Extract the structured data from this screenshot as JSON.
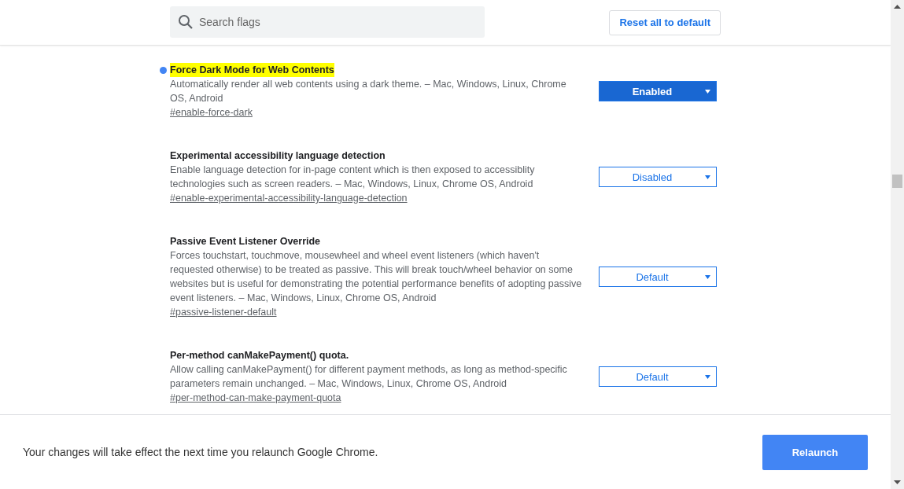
{
  "header": {
    "search": {
      "placeholder": "Search flags"
    },
    "reset_button": "Reset all to default"
  },
  "flags": [
    {
      "title": "Force Dark Mode for Web Contents",
      "modified": true,
      "highlighted": true,
      "description": "Automatically render all web contents using a dark theme. – Mac, Windows, Linux, Chrome OS, Android",
      "link": "#enable-force-dark",
      "value": "Enabled"
    },
    {
      "title": "Experimental accessibility language detection",
      "modified": false,
      "highlighted": false,
      "description": "Enable language detection for in-page content which is then exposed to accessiblity technologies such as screen readers. – Mac, Windows, Linux, Chrome OS, Android",
      "link": "#enable-experimental-accessibility-language-detection",
      "value": "Disabled"
    },
    {
      "title": "Passive Event Listener Override",
      "modified": false,
      "highlighted": false,
      "description": "Forces touchstart, touchmove, mousewheel and wheel event listeners (which haven't requested otherwise) to be treated as passive. This will break touch/wheel behavior on some websites but is useful for demonstrating the potential performance benefits of adopting passive event listeners. – Mac, Windows, Linux, Chrome OS, Android",
      "link": "#passive-listener-default",
      "value": "Default"
    },
    {
      "title": "Per-method canMakePayment() quota.",
      "modified": false,
      "highlighted": false,
      "description": "Allow calling canMakePayment() for different payment methods, as long as method-specific parameters remain unchanged. – Mac, Windows, Linux, Chrome OS, Android",
      "link": "#per-method-can-make-payment-quota",
      "value": "Default"
    }
  ],
  "footer": {
    "message": "Your changes will take effect the next time you relaunch Google Chrome.",
    "relaunch_button": "Relaunch"
  }
}
